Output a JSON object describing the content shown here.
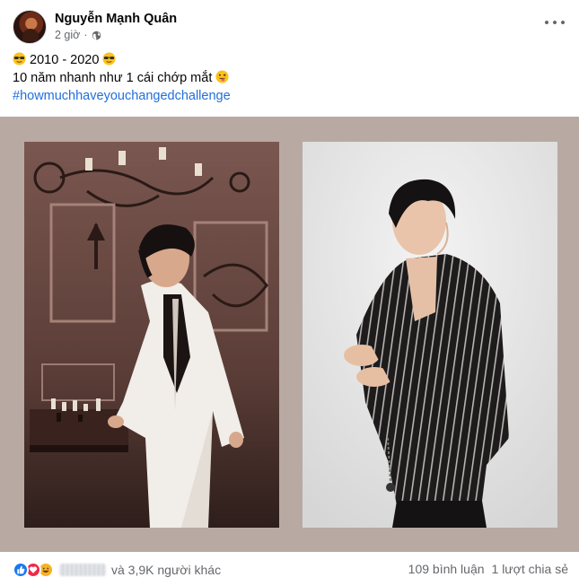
{
  "post": {
    "author": "Nguyễn Mạnh Quân",
    "time": "2 giờ",
    "privacy_icon": "globe-icon",
    "more_icon": "more-horizontal-icon",
    "lines": [
      {
        "pre_emoji": "sunglasses",
        "text": " 2010 - 2020 ",
        "post_emoji": "sunglasses"
      },
      {
        "text": "10 năm nhanh như 1 cái chớp mắt ",
        "post_emoji": "winking-tongue"
      }
    ],
    "hashtag": "#howmuchhaveyouchangedchallenge",
    "media_background": "#b9a9a3",
    "photos": [
      {
        "description": "2010 photo in white suit",
        "name": "photo-2010"
      },
      {
        "description": "2020 photo in striped shirt",
        "name": "photo-2020"
      }
    ]
  },
  "footer": {
    "reactions": [
      "like",
      "love",
      "haha"
    ],
    "others_text": "và 3,9K người khác",
    "comments_text": "109 bình luận",
    "shares_text": "1 lượt chia sẻ"
  },
  "colors": {
    "link": "#216fdb",
    "secondary_text": "#65676b",
    "like": "#1877f2",
    "love": "#f0284a",
    "haha": "#f7b125"
  }
}
